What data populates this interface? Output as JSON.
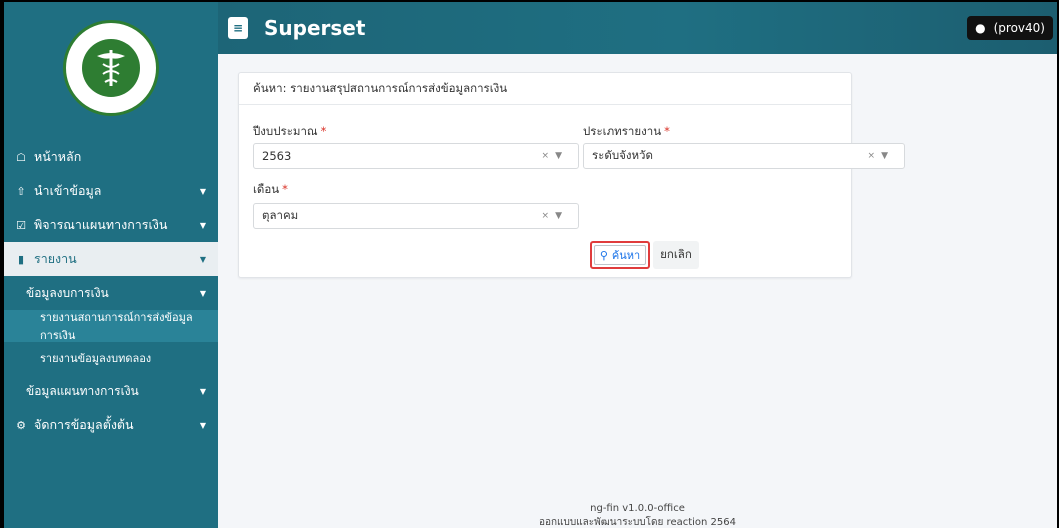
{
  "header": {
    "brand": "Superset",
    "user": "(prov40)"
  },
  "sidebar": {
    "items": [
      {
        "label": "หน้าหลัก",
        "icon": "home-icon"
      },
      {
        "label": "นำเข้าข้อมูล",
        "icon": "upload-icon"
      },
      {
        "label": "พิจารณาแผนทางการเงิน",
        "icon": "clipboard-check-icon"
      },
      {
        "label": "รายงาน",
        "icon": "file-icon"
      },
      {
        "label": "ข้อมูลงบการเงิน"
      },
      {
        "label": "รายงานสถานการณ์การส่งข้อมูลการเงิน"
      },
      {
        "label": "รายงานข้อมูลงบทดลอง"
      },
      {
        "label": "ข้อมูลแผนทางการเงิน"
      },
      {
        "label": "จัดการข้อมูลตั้งต้น",
        "icon": "gear-icon"
      }
    ]
  },
  "card": {
    "title": "ค้นหา: รายงานสรุปสถานการณ์การส่งข้อมูลการเงิน",
    "fields": {
      "fiscal_year": {
        "label": "ปีงบประมาณ",
        "required": "*",
        "value": "2563"
      },
      "report_type": {
        "label": "ประเภทรายงาน",
        "required": "*",
        "value": "ระดับจังหวัด"
      },
      "month": {
        "label": "เดือน",
        "required": "*",
        "value": "ตุลาคม"
      }
    },
    "search_label": "ค้นหา",
    "cancel_label": "ยกเลิก"
  },
  "footer": {
    "version": "ng-fin v1.0.0-office",
    "credit": "ออกแบบและพัฒนาระบบโดย reaction 2564"
  }
}
